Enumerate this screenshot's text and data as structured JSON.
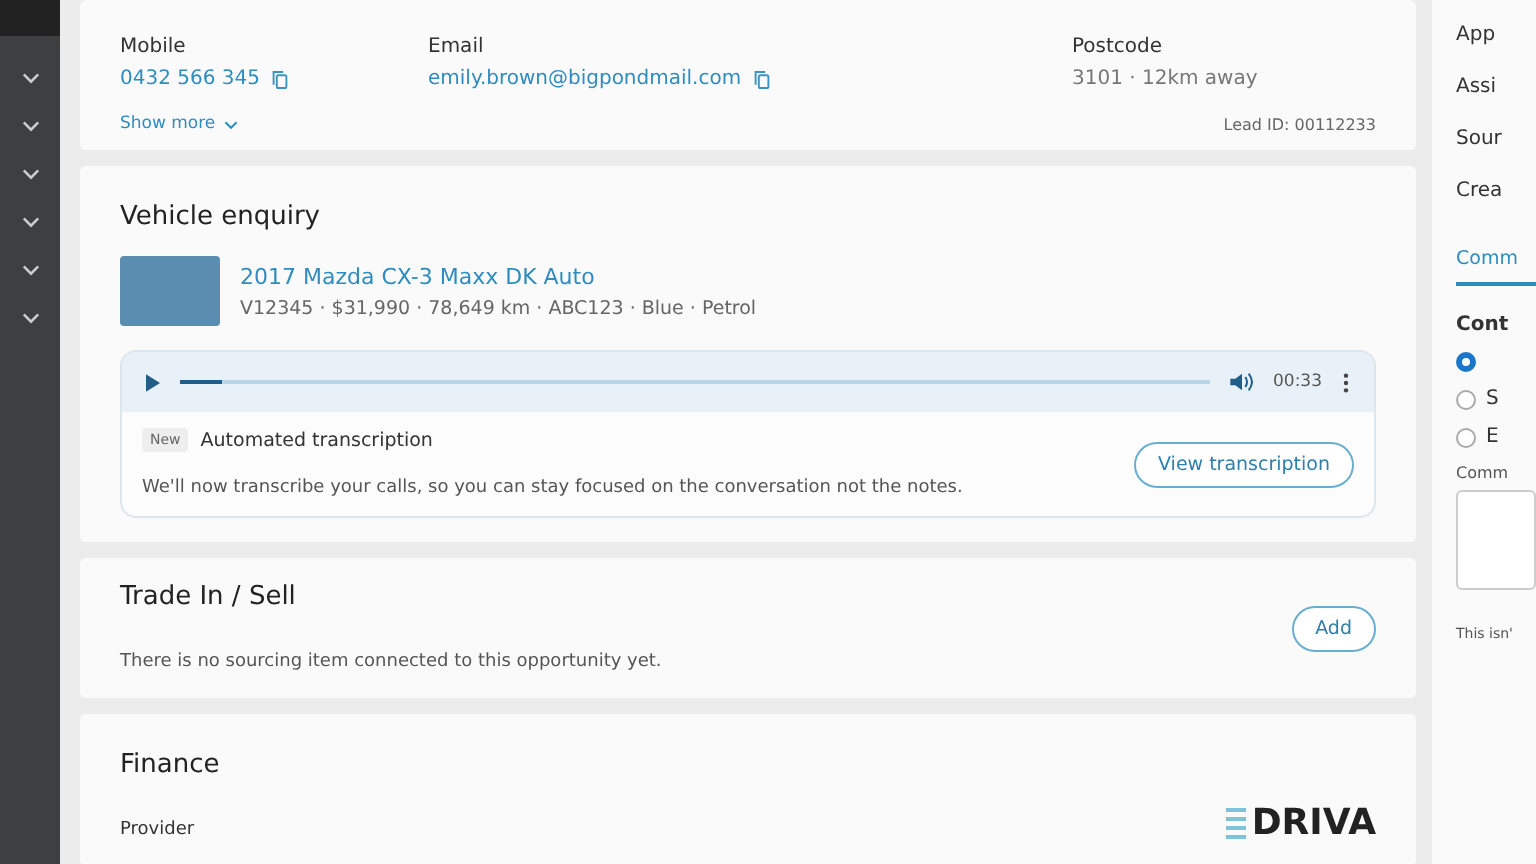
{
  "contact": {
    "fields": [
      {
        "label": "Mobile",
        "value": "0432 566 345",
        "kind": "link"
      },
      {
        "label": "Email",
        "value": "emily.brown@bigpondmail.com",
        "kind": "link"
      },
      {
        "label": "Postcode",
        "value": "3101 · 12km away",
        "kind": "plain"
      }
    ],
    "show_more": "Show more",
    "lead_id": "Lead ID: 00112233"
  },
  "vehicle_enquiry": {
    "title": "Vehicle enquiry",
    "vehicle": {
      "name": "2017 Mazda CX-3 Maxx DK Auto",
      "details": "V12345 · $31,990 · 78,649 km · ABC123 · Blue · Petrol"
    },
    "audio": {
      "level": 0.04,
      "time": "00:33"
    },
    "transcription": {
      "badge": "New",
      "title": "Automated transcription",
      "text": "We'll now transcribe your calls, so you can stay focused on the conversation not the notes.",
      "button": "View transcription"
    }
  },
  "trade_in": {
    "title": "Trade In / Sell",
    "text": "There is no sourcing item connected to this opportunity yet.",
    "button": "Add"
  },
  "finance": {
    "title": "Finance",
    "provider_label": "Provider",
    "logo": "DRIVA"
  },
  "right_panel": {
    "labels": [
      "App",
      "Assi",
      "Sour",
      "Crea"
    ],
    "tab": {
      "label": "Comm",
      "selected": true
    },
    "contact_label": "Cont",
    "radios": [
      {
        "selected": true
      },
      {
        "label": "S",
        "selected": false
      },
      {
        "label": "E",
        "selected": false
      }
    ],
    "comment_label": "Comm",
    "note": "This isn'"
  }
}
